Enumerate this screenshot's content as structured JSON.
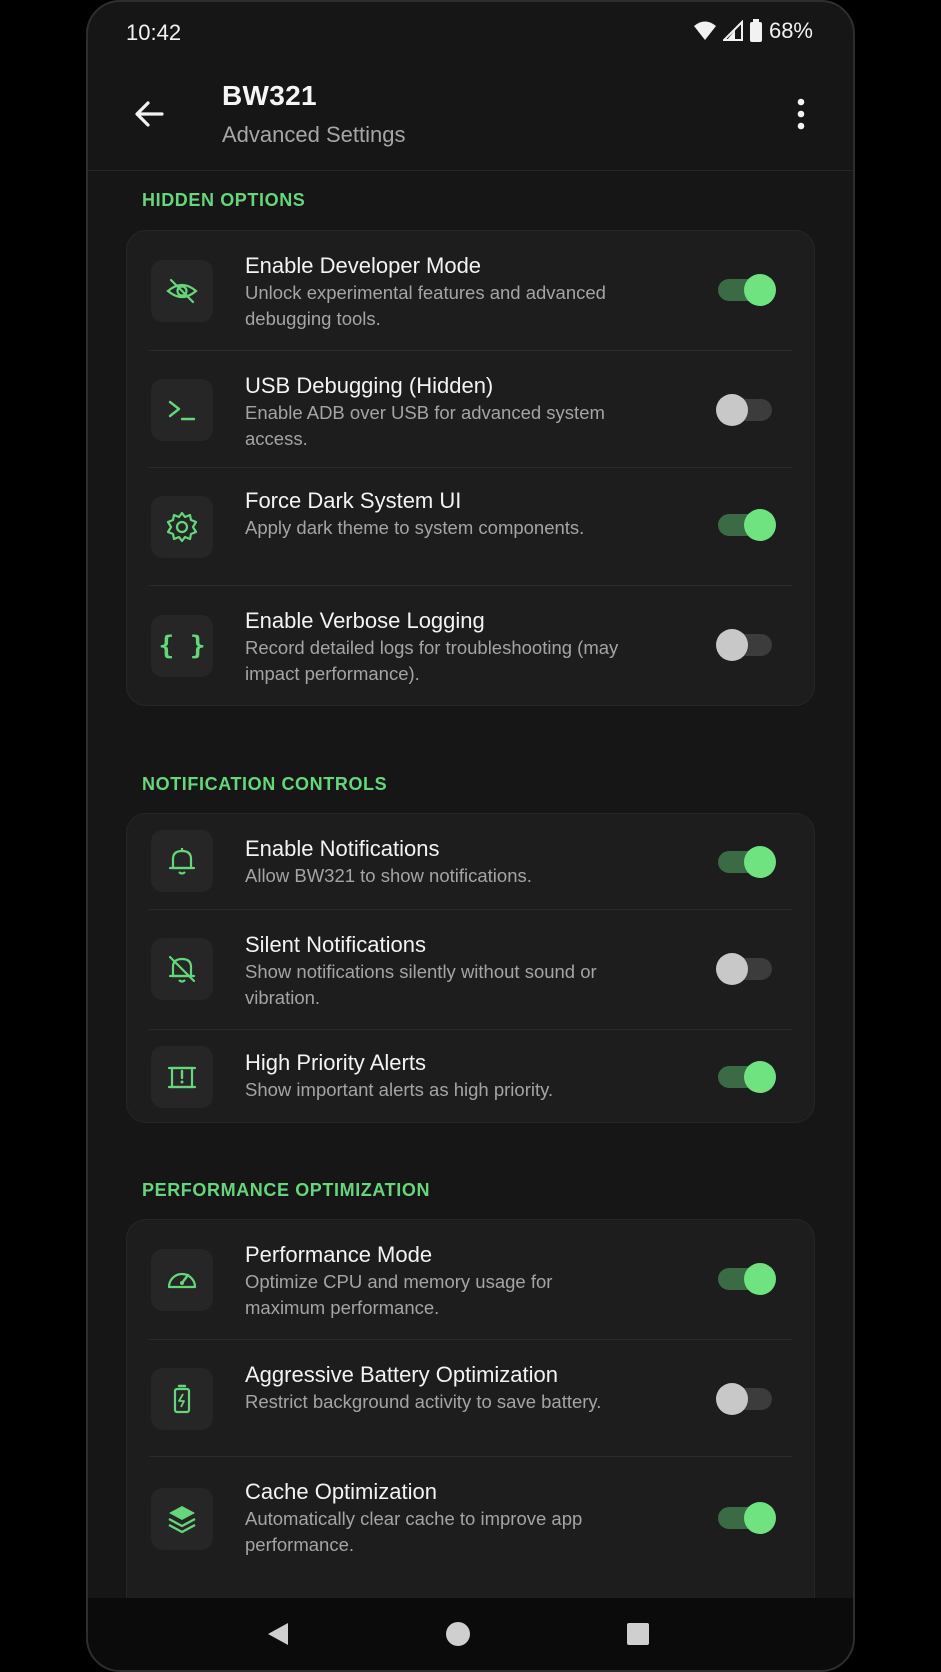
{
  "status_bar": {
    "time": "10:42",
    "battery": "68%"
  },
  "app_bar": {
    "title": "BW321",
    "subtitle": "Advanced Settings"
  },
  "sections": [
    {
      "label": "HIDDEN OPTIONS",
      "items": [
        {
          "title": "Enable Developer Mode",
          "desc": "Unlock experimental features and advanced debugging tools.",
          "icon": "eye-off-icon",
          "on": true
        },
        {
          "title": "USB Debugging (Hidden)",
          "desc": "Enable ADB over USB for advanced system access.",
          "icon": "terminal-icon",
          "on": false
        },
        {
          "title": "Force Dark System UI",
          "desc": "Apply dark theme to system components.",
          "icon": "gear-icon",
          "on": true
        },
        {
          "title": "Enable Verbose Logging",
          "desc": "Record detailed logs for troubleshooting (may impact performance).",
          "icon": "braces-icon",
          "on": false
        }
      ]
    },
    {
      "label": "NOTIFICATION CONTROLS",
      "items": [
        {
          "title": "Enable Notifications",
          "desc": "Allow BW321 to show notifications.",
          "icon": "bell-icon",
          "on": true
        },
        {
          "title": "Silent Notifications",
          "desc": "Show notifications silently without sound or vibration.",
          "icon": "bell-off-icon",
          "on": false
        },
        {
          "title": "High Priority Alerts",
          "desc": "Show important alerts as high priority.",
          "icon": "priority-alert-icon",
          "on": true
        }
      ]
    },
    {
      "label": "PERFORMANCE OPTIMIZATION",
      "items": [
        {
          "title": "Performance Mode",
          "desc": "Optimize CPU and memory usage for maximum performance.",
          "icon": "speedometer-icon",
          "on": true
        },
        {
          "title": "Aggressive Battery Optimization",
          "desc": "Restrict background activity to save battery.",
          "icon": "battery-icon",
          "on": false
        },
        {
          "title": "Cache Optimization",
          "desc": "Automatically clear cache to improve app performance.",
          "icon": "layers-icon",
          "on": true
        }
      ]
    }
  ],
  "colors": {
    "accent": "#63d77a",
    "toggle_on_thumb": "#6ee37f",
    "background": "#161616",
    "card": "#1d1d1d"
  }
}
